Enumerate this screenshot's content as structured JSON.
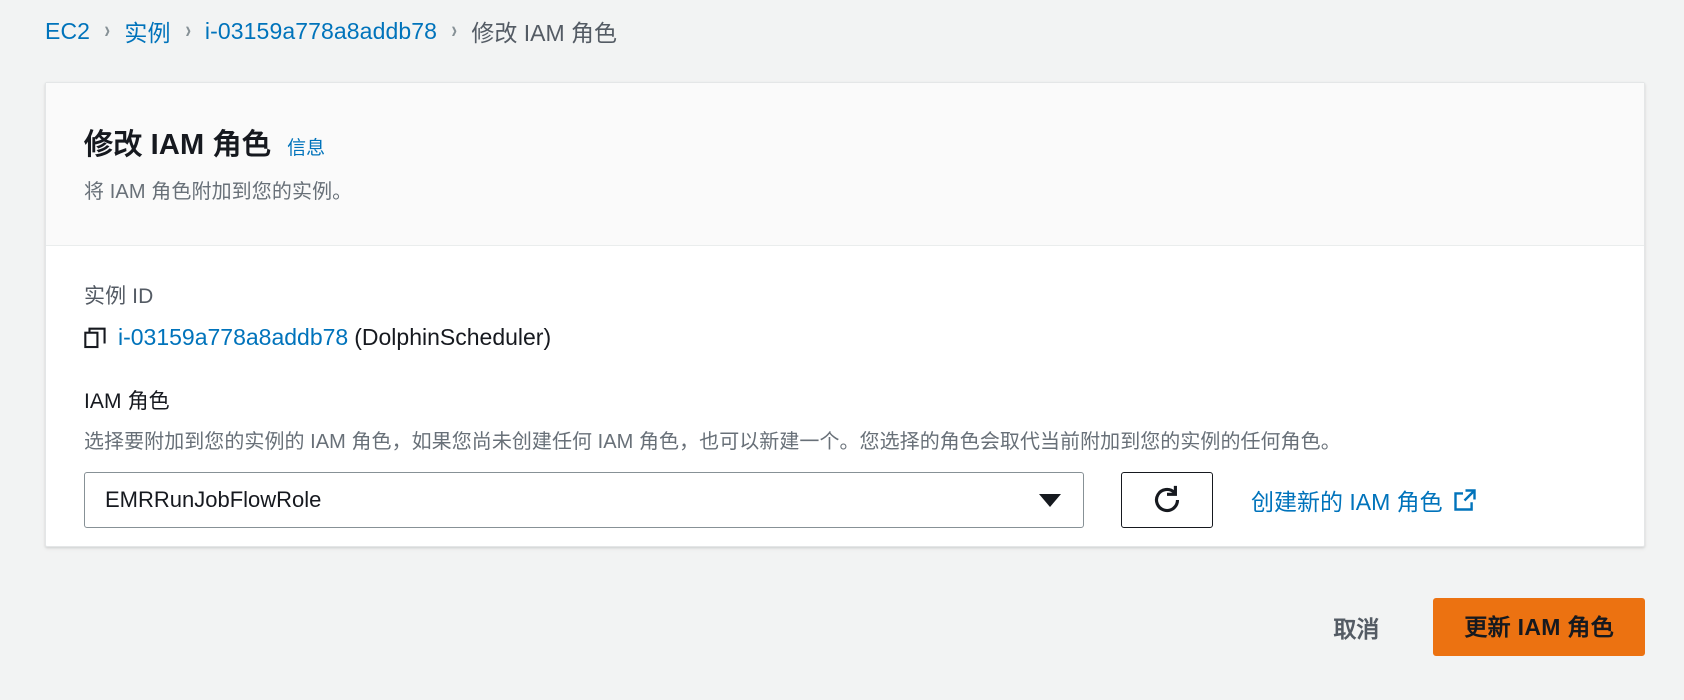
{
  "breadcrumb": {
    "items": [
      {
        "label": "EC2",
        "current": false
      },
      {
        "label": "实例",
        "current": false
      },
      {
        "label": "i-03159a778a8addb78",
        "current": false
      },
      {
        "label": "修改 IAM 角色",
        "current": true
      }
    ],
    "separator": "›"
  },
  "card": {
    "title": "修改 IAM 角色",
    "info_link": "信息",
    "subtitle": "将 IAM 角色附加到您的实例。",
    "instance": {
      "label": "实例 ID",
      "id": "i-03159a778a8addb78",
      "name": "(DolphinScheduler)",
      "copy_icon": "copy-icon"
    },
    "iam_role": {
      "label": "IAM 角色",
      "description": "选择要附加到您的实例的 IAM 角色，如果您尚未创建任何 IAM 角色，也可以新建一个。您选择的角色会取代当前附加到您的实例的任何角色。",
      "select_value": "EMRRunJobFlowRole",
      "caret_icon": "chevron-down-icon",
      "refresh_icon": "refresh-icon",
      "create_link": "创建新的 IAM 角色",
      "external_icon": "external-link-icon"
    }
  },
  "footer": {
    "cancel_label": "取消",
    "submit_label": "更新 IAM 角色"
  },
  "colors": {
    "link": "#0073bb",
    "primary_button": "#ec7211",
    "page_background": "#f2f3f3",
    "card_header_background": "#fafafa",
    "muted_text": "#687078"
  }
}
